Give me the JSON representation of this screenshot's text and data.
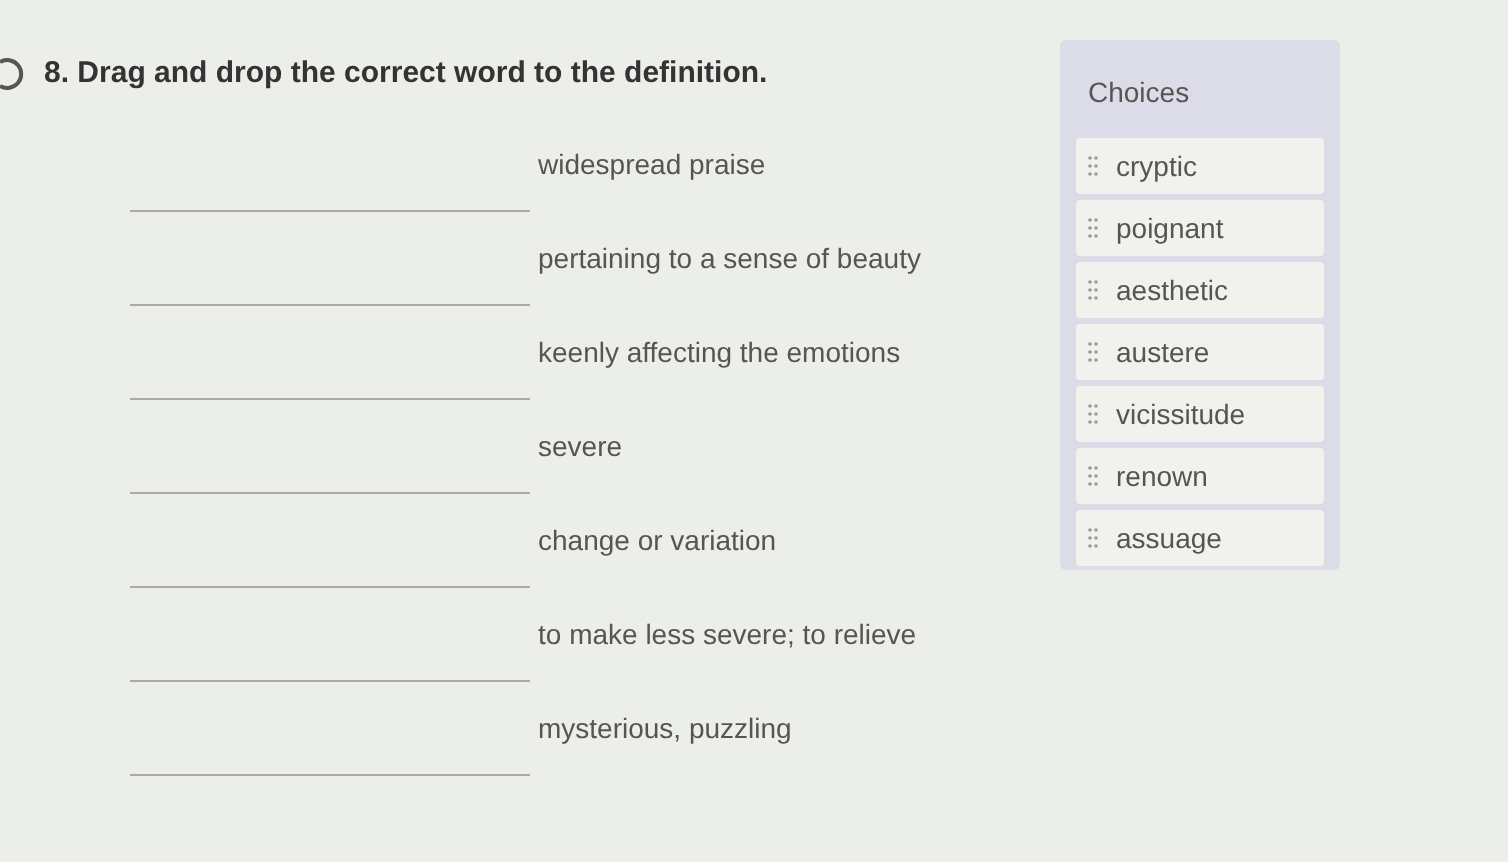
{
  "question": {
    "number": "8.",
    "text": "Drag and drop the correct word to the definition."
  },
  "definitions": [
    {
      "text": "widespread praise"
    },
    {
      "text": "pertaining to a sense of beauty"
    },
    {
      "text": "keenly affecting the emotions"
    },
    {
      "text": "severe"
    },
    {
      "text": "change or variation"
    },
    {
      "text": "to make less severe; to relieve"
    },
    {
      "text": "mysterious, puzzling"
    }
  ],
  "choices": {
    "title": "Choices",
    "items": [
      "cryptic",
      "poignant",
      "aesthetic",
      "austere",
      "vicissitude",
      "renown",
      "assuage"
    ]
  }
}
